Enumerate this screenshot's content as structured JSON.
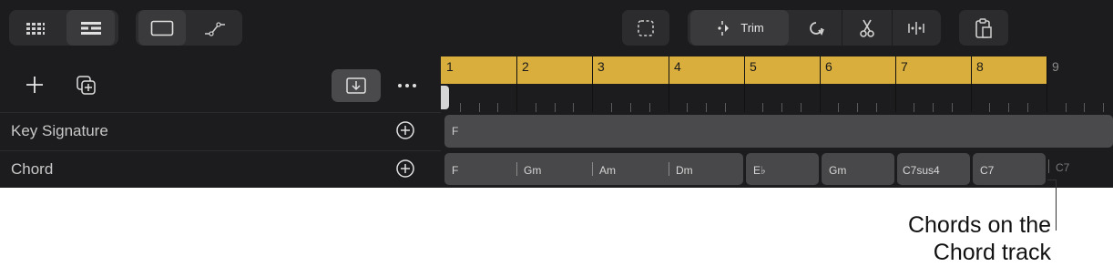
{
  "toolbar": {
    "trim_label": "Trim"
  },
  "ruler": {
    "bars": [
      "1",
      "2",
      "3",
      "4",
      "5",
      "6",
      "7",
      "8",
      "9"
    ]
  },
  "tracks": [
    {
      "label": "Key Signature"
    },
    {
      "label": "Chord"
    }
  ],
  "key_signature": {
    "value": "F"
  },
  "chords": [
    {
      "name": "F"
    },
    {
      "name": "Gm"
    },
    {
      "name": "Am"
    },
    {
      "name": "Dm"
    },
    {
      "name": "E♭"
    },
    {
      "name": "Gm"
    },
    {
      "name": "C7sus4"
    },
    {
      "name": "C7"
    },
    {
      "name": "C7"
    }
  ],
  "callout": {
    "line1": "Chords on the",
    "line2": "Chord track"
  },
  "colors": {
    "ruler_cycle": "#d9ae3d",
    "background": "#1c1c1e",
    "region": "#48484a"
  }
}
